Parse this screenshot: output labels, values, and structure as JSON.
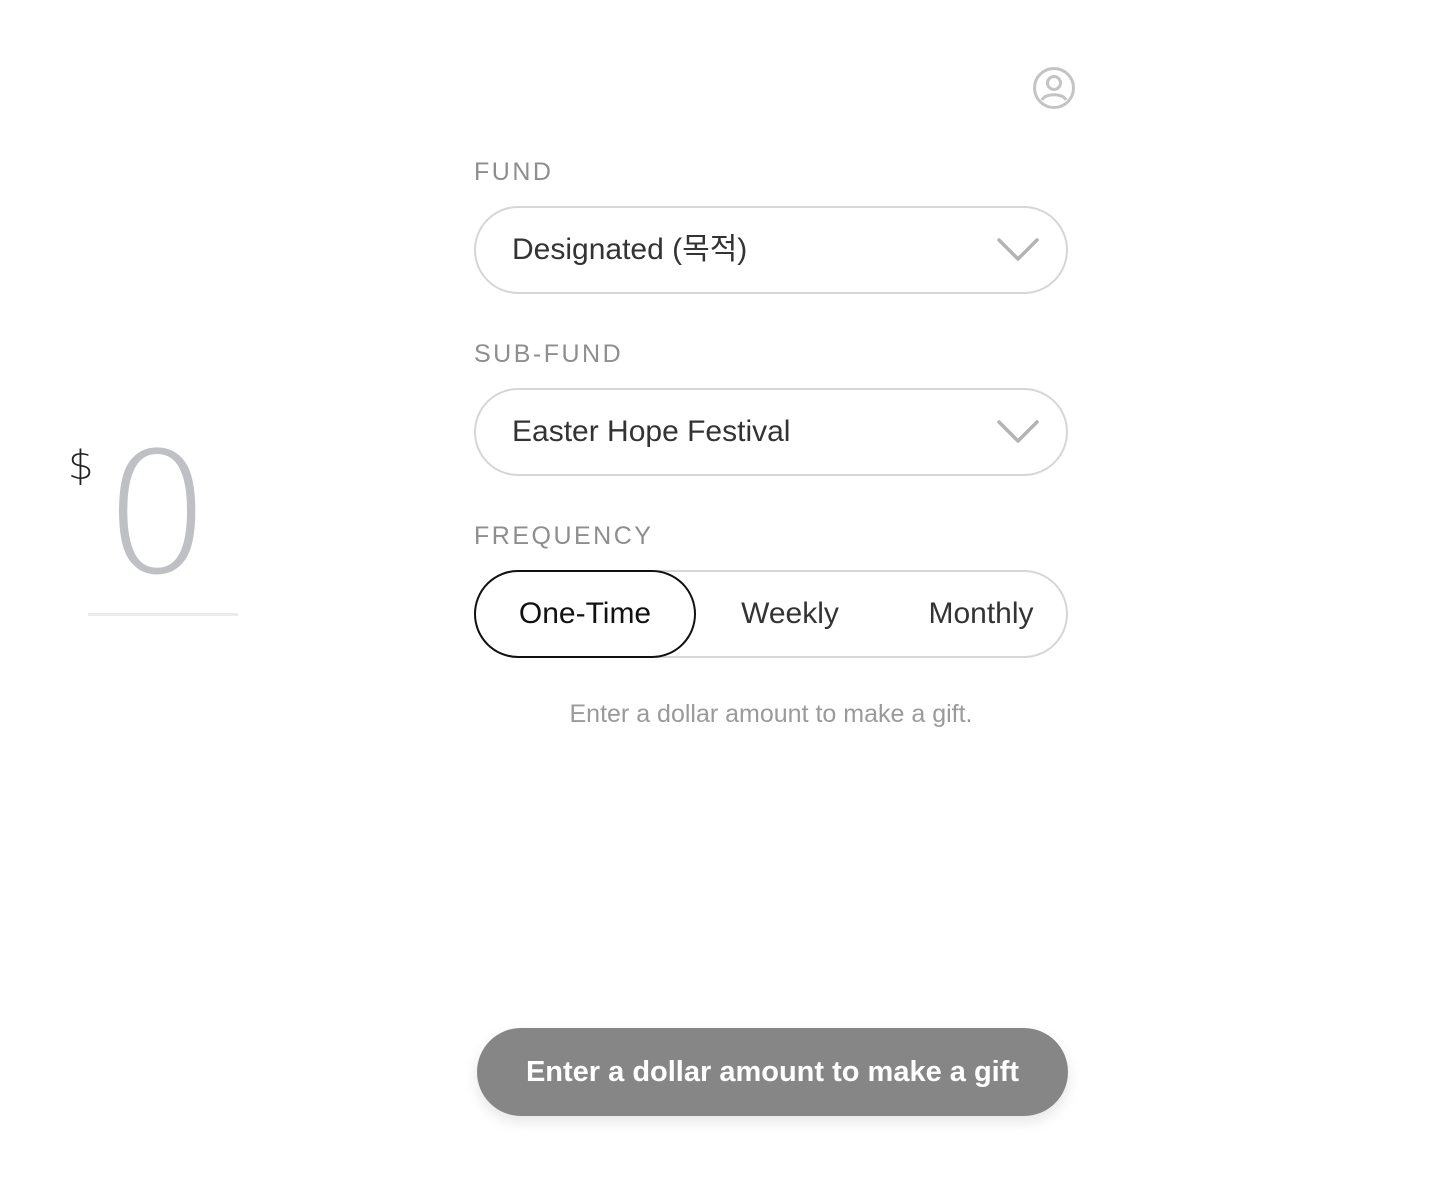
{
  "amount": {
    "currency_symbol": "$",
    "value": "0"
  },
  "profile": {
    "icon": "user-circle-icon"
  },
  "fund": {
    "label": "FUND",
    "selected": "Designated (목적)",
    "icon": "chevron-down-icon"
  },
  "sub_fund": {
    "label": "SUB-FUND",
    "selected": "Easter Hope Festival",
    "icon": "chevron-down-icon"
  },
  "frequency": {
    "label": "FREQUENCY",
    "options": [
      {
        "label": "One-Time",
        "selected": true
      },
      {
        "label": "Weekly",
        "selected": false
      },
      {
        "label": "Monthly",
        "selected": false
      }
    ]
  },
  "hint": "Enter a dollar amount to make a gift.",
  "submit": {
    "label": "Enter a dollar amount to make a gift",
    "enabled": false
  },
  "colors": {
    "button_disabled": "#868686",
    "border": "#d6d6d6",
    "active_border": "#111111",
    "label": "#8e8e8e",
    "amount_placeholder": "#bfc0c4"
  }
}
